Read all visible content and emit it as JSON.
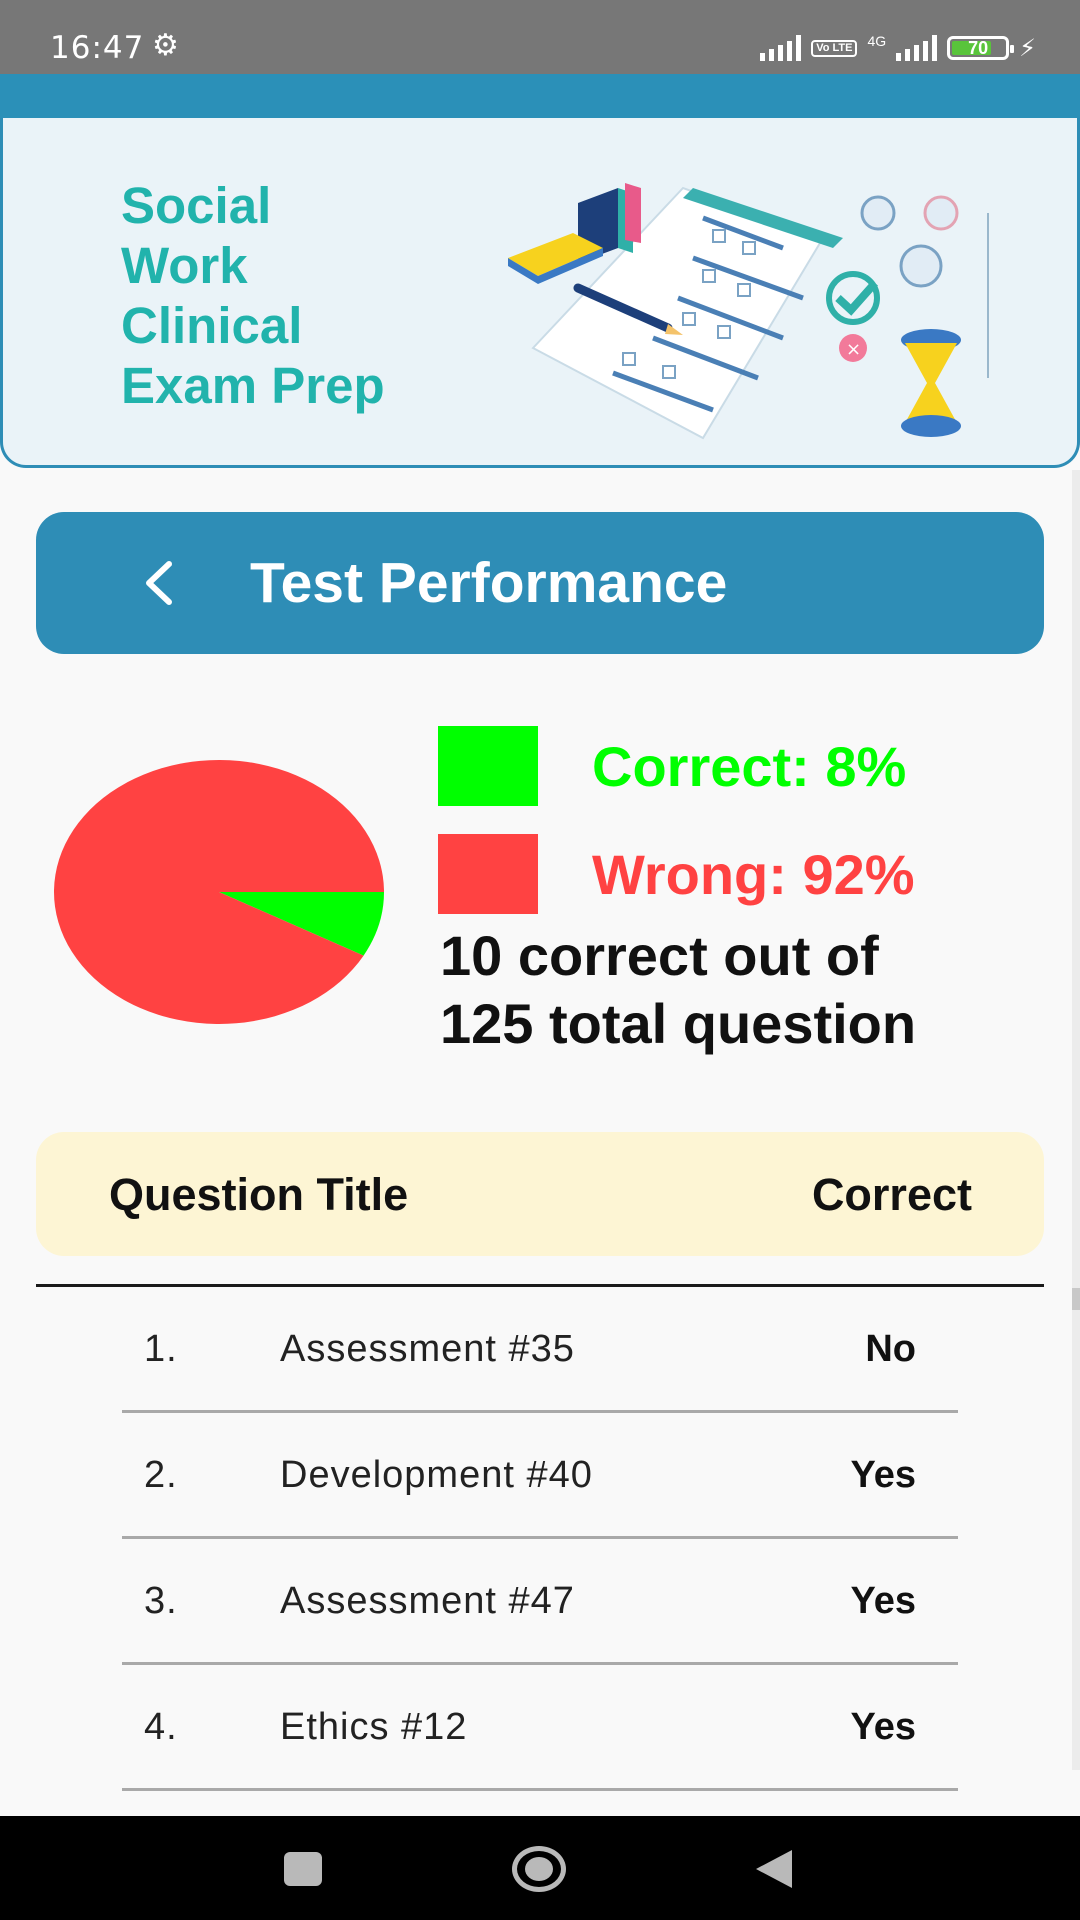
{
  "status_bar": {
    "time": "16:47",
    "network": "4G",
    "volte": "Vo LTE",
    "battery": "70",
    "battery_level": 0.7
  },
  "banner": {
    "title": "Social\nWork\nClinical\nExam Prep",
    "title_color": "#21b3ac"
  },
  "header": {
    "title": "Test Performance",
    "back_icon": "chevron-left-icon",
    "color": "#2e8db6"
  },
  "chart_data": {
    "type": "pie",
    "slices": [
      {
        "label": "Correct",
        "value": 8,
        "color": "#00ff00"
      },
      {
        "label": "Wrong",
        "value": 92,
        "color": "#ff4242"
      }
    ]
  },
  "legend": {
    "correct": {
      "text": "Correct: 8%",
      "color": "#00ff00"
    },
    "wrong": {
      "text": "Wrong: 92%",
      "color": "#ff4242"
    }
  },
  "summary": {
    "line1": "10 correct out of",
    "line2": "125 total question"
  },
  "table": {
    "col_title": "Question Title",
    "col_correct": "Correct",
    "rows": [
      {
        "num": "1.",
        "title": "Assessment #35",
        "correct": "No"
      },
      {
        "num": "2.",
        "title": "Development #40",
        "correct": "Yes"
      },
      {
        "num": "3.",
        "title": "Assessment #47",
        "correct": "Yes"
      },
      {
        "num": "4.",
        "title": "Ethics #12",
        "correct": "Yes"
      }
    ]
  },
  "nav": {
    "recents_icon": "square-icon",
    "home_icon": "circle-home-icon",
    "back_icon": "triangle-back-icon"
  }
}
